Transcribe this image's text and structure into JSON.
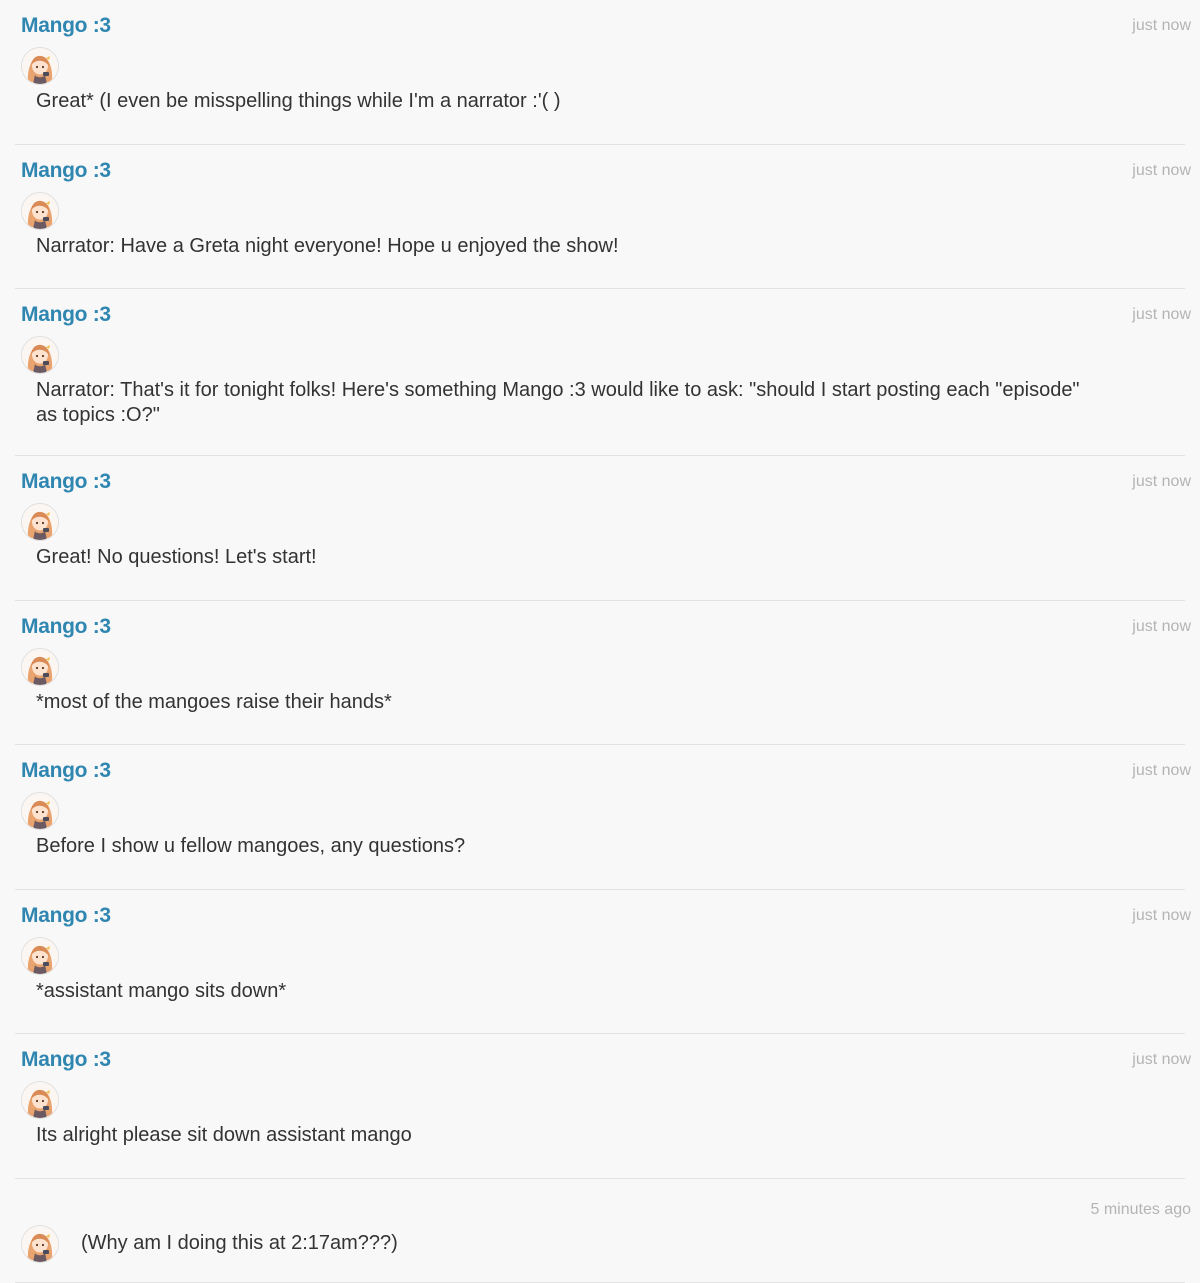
{
  "posts": [
    {
      "author": "Mango :3",
      "time": "just now",
      "text": "Great* (I even be misspelling things while I'm a narrator :'( )"
    },
    {
      "author": "Mango :3",
      "time": "just now",
      "text": "Narrator: Have a Greta night everyone! Hope u enjoyed the show!"
    },
    {
      "author": "Mango :3",
      "time": "just now",
      "text": "Narrator: That's it for tonight folks! Here's something Mango :3 would like to ask: \"should I start posting each \"episode\" as topics :O?\""
    },
    {
      "author": "Mango :3",
      "time": "just now",
      "text": "Great! No questions! Let's start!"
    },
    {
      "author": "Mango :3",
      "time": "just now",
      "text": "*most of the mangoes raise their hands*"
    },
    {
      "author": "Mango :3",
      "time": "just now",
      "text": "Before I show u fellow mangoes, any questions?"
    },
    {
      "author": "Mango :3",
      "time": "just now",
      "text": "*assistant mango sits down*"
    },
    {
      "author": "Mango :3",
      "time": "just now",
      "text": "Its alright please sit down assistant mango"
    },
    {
      "time": "5 minutes ago",
      "text": "(Why am I doing this at 2:17am???)"
    }
  ],
  "avatar_icon": "anime-girl-avatar-icon",
  "colors": {
    "author": "#2f86b1",
    "timestamp": "#b4b4b4",
    "text": "#333333",
    "background": "#f8f8f8",
    "divider": "#e3e3e3"
  }
}
